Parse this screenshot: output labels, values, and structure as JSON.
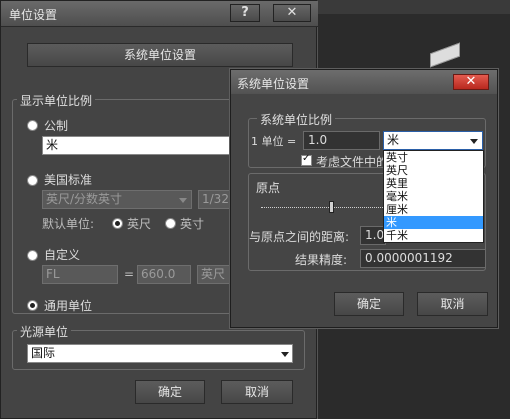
{
  "main_dialog": {
    "title": "单位设置",
    "help_label": "?",
    "close_label": "✕",
    "system_button": "系统单位设置",
    "display_group": {
      "label": "显示单位比例",
      "metric": {
        "label": "公制",
        "selected": false,
        "value": "米"
      },
      "us": {
        "label": "美国标准",
        "selected": false,
        "unit_value": "英尺/分数英寸",
        "fraction_value": "1/32",
        "default_unit_label": "默认单位:",
        "feet_label": "英尺",
        "inch_label": "英寸",
        "default_unit": "英尺"
      },
      "custom": {
        "label": "自定义",
        "selected": false,
        "name_value": "FL",
        "equals": "=",
        "number_value": "660.0",
        "unit_value": "英尺"
      },
      "generic": {
        "label": "通用单位",
        "selected": true
      }
    },
    "lighting_group": {
      "label": "光源单位",
      "value": "国际"
    },
    "ok_button": "确定",
    "cancel_button": "取消"
  },
  "system_dialog": {
    "title": "系统单位设置",
    "close_label": "✕",
    "scale_group": {
      "label": "系统单位比例",
      "unit_prefix": "1 单位 =",
      "unit_value": "1.0",
      "unit_select": "米",
      "consider_files_label": "考虑文件中的",
      "consider_files_checked": true,
      "dropdown_options": [
        "英寸",
        "英尺",
        "英里",
        "毫米",
        "厘米",
        "米",
        "千米"
      ],
      "dropdown_selected_index": 5
    },
    "origin_group": {
      "label": "原点",
      "distance_label": "与原点之间的距离:",
      "distance_value": "1.0",
      "precision_label": "结果精度:",
      "precision_value": "0.0000001192"
    },
    "ok_button": "确定",
    "cancel_button": "取消"
  },
  "colors": {
    "dialog_bg": "#444444",
    "selection": "#3399ff",
    "close_red": "#c83a2e"
  }
}
